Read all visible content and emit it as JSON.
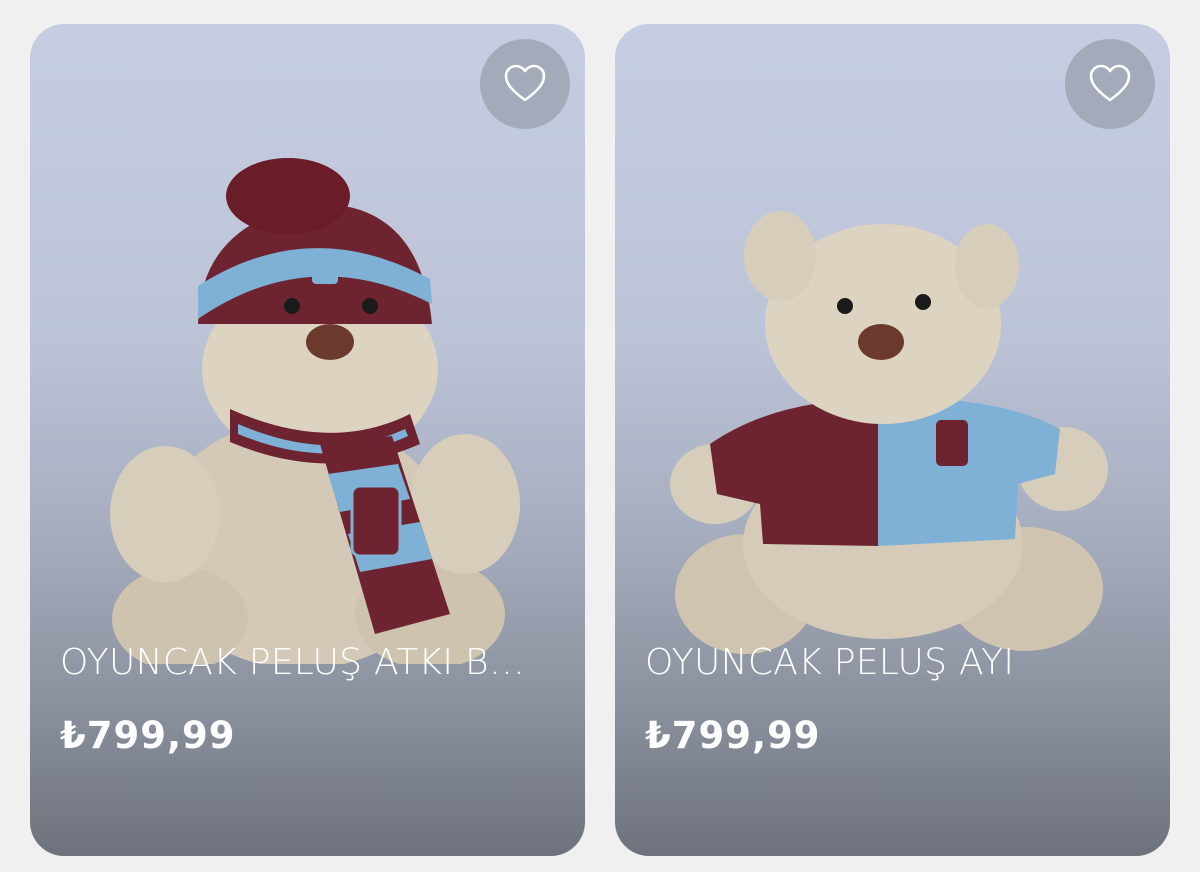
{
  "products": [
    {
      "title": "OYUNCAK PELUŞ ATKI BE...",
      "price": "₺799,99",
      "image": "plush-bear-hat-scarf",
      "favorite_icon": "heart-outline-icon"
    },
    {
      "title": "OYUNCAK PELUŞ AYI",
      "price": "₺799,99",
      "image": "plush-bear-jersey",
      "favorite_icon": "heart-outline-icon"
    }
  ],
  "colors": {
    "claret": "#6e2430",
    "sky_blue": "#7fb0d6",
    "bear_fur": "#d7cdbb",
    "text": "#ffffff"
  }
}
